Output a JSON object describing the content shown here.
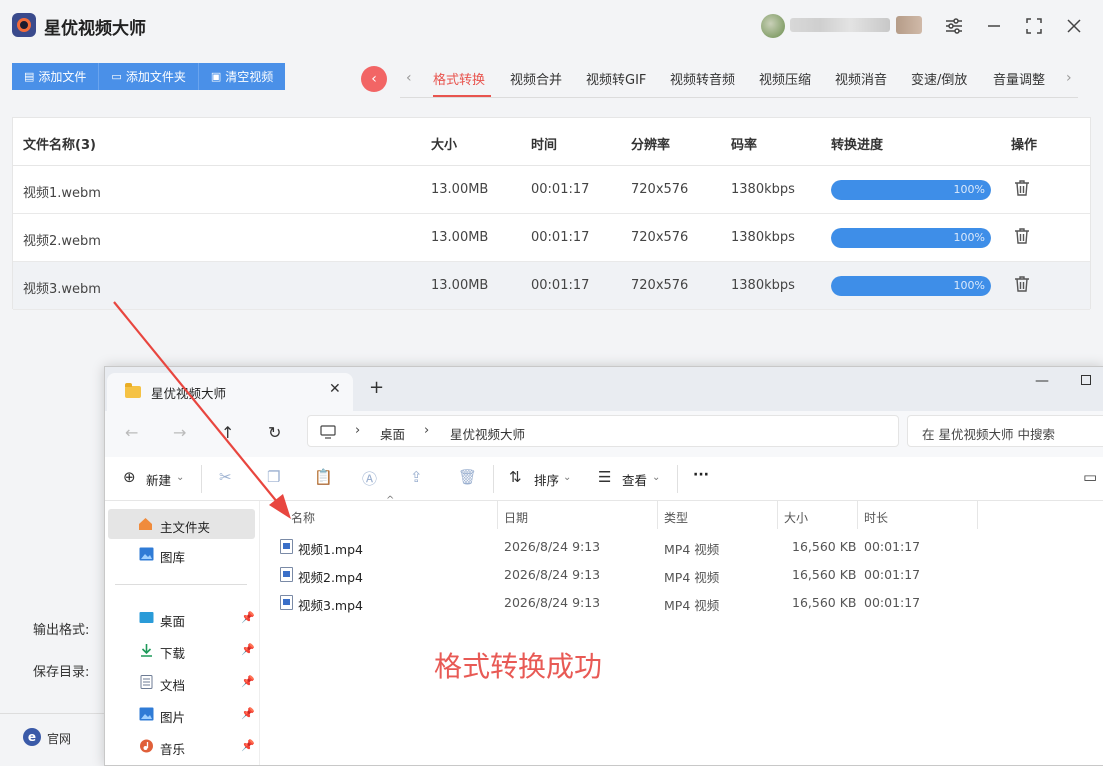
{
  "app": {
    "name": "星优视频大师"
  },
  "toolbar": {
    "add_file": "添加文件",
    "add_folder": "添加文件夹",
    "clear_videos": "清空视频"
  },
  "tabs": [
    "格式转换",
    "视频合并",
    "视频转GIF",
    "视频转音频",
    "视频压缩",
    "视频消音",
    "变速/倒放",
    "音量调整"
  ],
  "active_tab": "格式转换",
  "table": {
    "headers": {
      "name": "文件名称(3)",
      "size": "大小",
      "time": "时间",
      "resolution": "分辨率",
      "bitrate": "码率",
      "progress": "转换进度",
      "action": "操作"
    },
    "rows": [
      {
        "name": "视频1.webm",
        "size": "13.00MB",
        "time": "00:01:17",
        "resolution": "720x576",
        "bitrate": "1380kbps",
        "progress": 100,
        "progress_text": "100%"
      },
      {
        "name": "视频2.webm",
        "size": "13.00MB",
        "time": "00:01:17",
        "resolution": "720x576",
        "bitrate": "1380kbps",
        "progress": 100,
        "progress_text": "100%"
      },
      {
        "name": "视频3.webm",
        "size": "13.00MB",
        "time": "00:01:17",
        "resolution": "720x576",
        "bitrate": "1380kbps",
        "progress": 100,
        "progress_text": "100%"
      }
    ]
  },
  "settings": {
    "output_format_label": "输出格式:",
    "save_dir_label": "保存目录:"
  },
  "footer": {
    "website": "官网"
  },
  "explorer": {
    "tab_title": "星优视频大师",
    "path": [
      "桌面",
      "星优视频大师"
    ],
    "search_placeholder": "在 星优视频大师 中搜索",
    "commands": {
      "new": "新建",
      "sort": "排序",
      "view": "查看",
      "more": "···"
    },
    "sidebar": {
      "home": "主文件夹",
      "gallery": "图库",
      "desktop": "桌面",
      "downloads": "下载",
      "documents": "文档",
      "pictures": "图片",
      "music": "音乐"
    },
    "columns": {
      "name": "名称",
      "date": "日期",
      "type": "类型",
      "size": "大小",
      "duration": "时长"
    },
    "files": [
      {
        "name": "视频1.mp4",
        "date": "2026/8/24 9:13",
        "type": "MP4 视频",
        "size": "16,560 KB",
        "duration": "00:01:17"
      },
      {
        "name": "视频2.mp4",
        "date": "2026/8/24 9:13",
        "type": "MP4 视频",
        "size": "16,560 KB",
        "duration": "00:01:17"
      },
      {
        "name": "视频3.mp4",
        "date": "2026/8/24 9:13",
        "type": "MP4 视频",
        "size": "16,560 KB",
        "duration": "00:01:17"
      }
    ]
  },
  "annotation": {
    "text": "格式转换成功",
    "color": "#e85a55"
  },
  "colors": {
    "accent_blue": "#4a90e8",
    "accent_red": "#e8544e",
    "progress": "#3e8ee8"
  }
}
